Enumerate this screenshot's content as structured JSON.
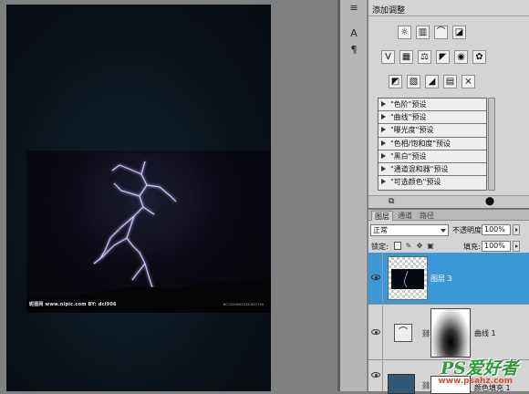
{
  "adjustments": {
    "title": "添加调整",
    "presets": [
      "\"色阶\"预设",
      "\"曲线\"预设",
      "\"曝光度\"预设",
      "\"色相/饱和度\"预设",
      "\"黑白\"预设",
      "\"通道混和器\"预设",
      "\"可选颜色\"预设"
    ]
  },
  "layers": {
    "tabs": [
      "图层",
      "通道",
      "路径"
    ],
    "blend_mode": "正常",
    "opacity_label": "不透明度:",
    "opacity_value": "100%",
    "lock_label": "锁定:",
    "fill_label": "填充:",
    "fill_value": "100%",
    "items": [
      {
        "name": "图层 3"
      },
      {
        "name": "曲线 1"
      },
      {
        "name": "颜色填充 1"
      }
    ]
  },
  "watermark": {
    "left": "昵图网 www.nipic.com BY: dcl906",
    "right": "NO.20040615250623750",
    "site_main": "PS爱好者",
    "site_url": "www.psahz.com"
  },
  "colors": {
    "selection": "#3b98d6",
    "panel_bg": "#d4d4d4",
    "canvas_bg": "#808080",
    "site_logo": "#2e9a3c"
  }
}
